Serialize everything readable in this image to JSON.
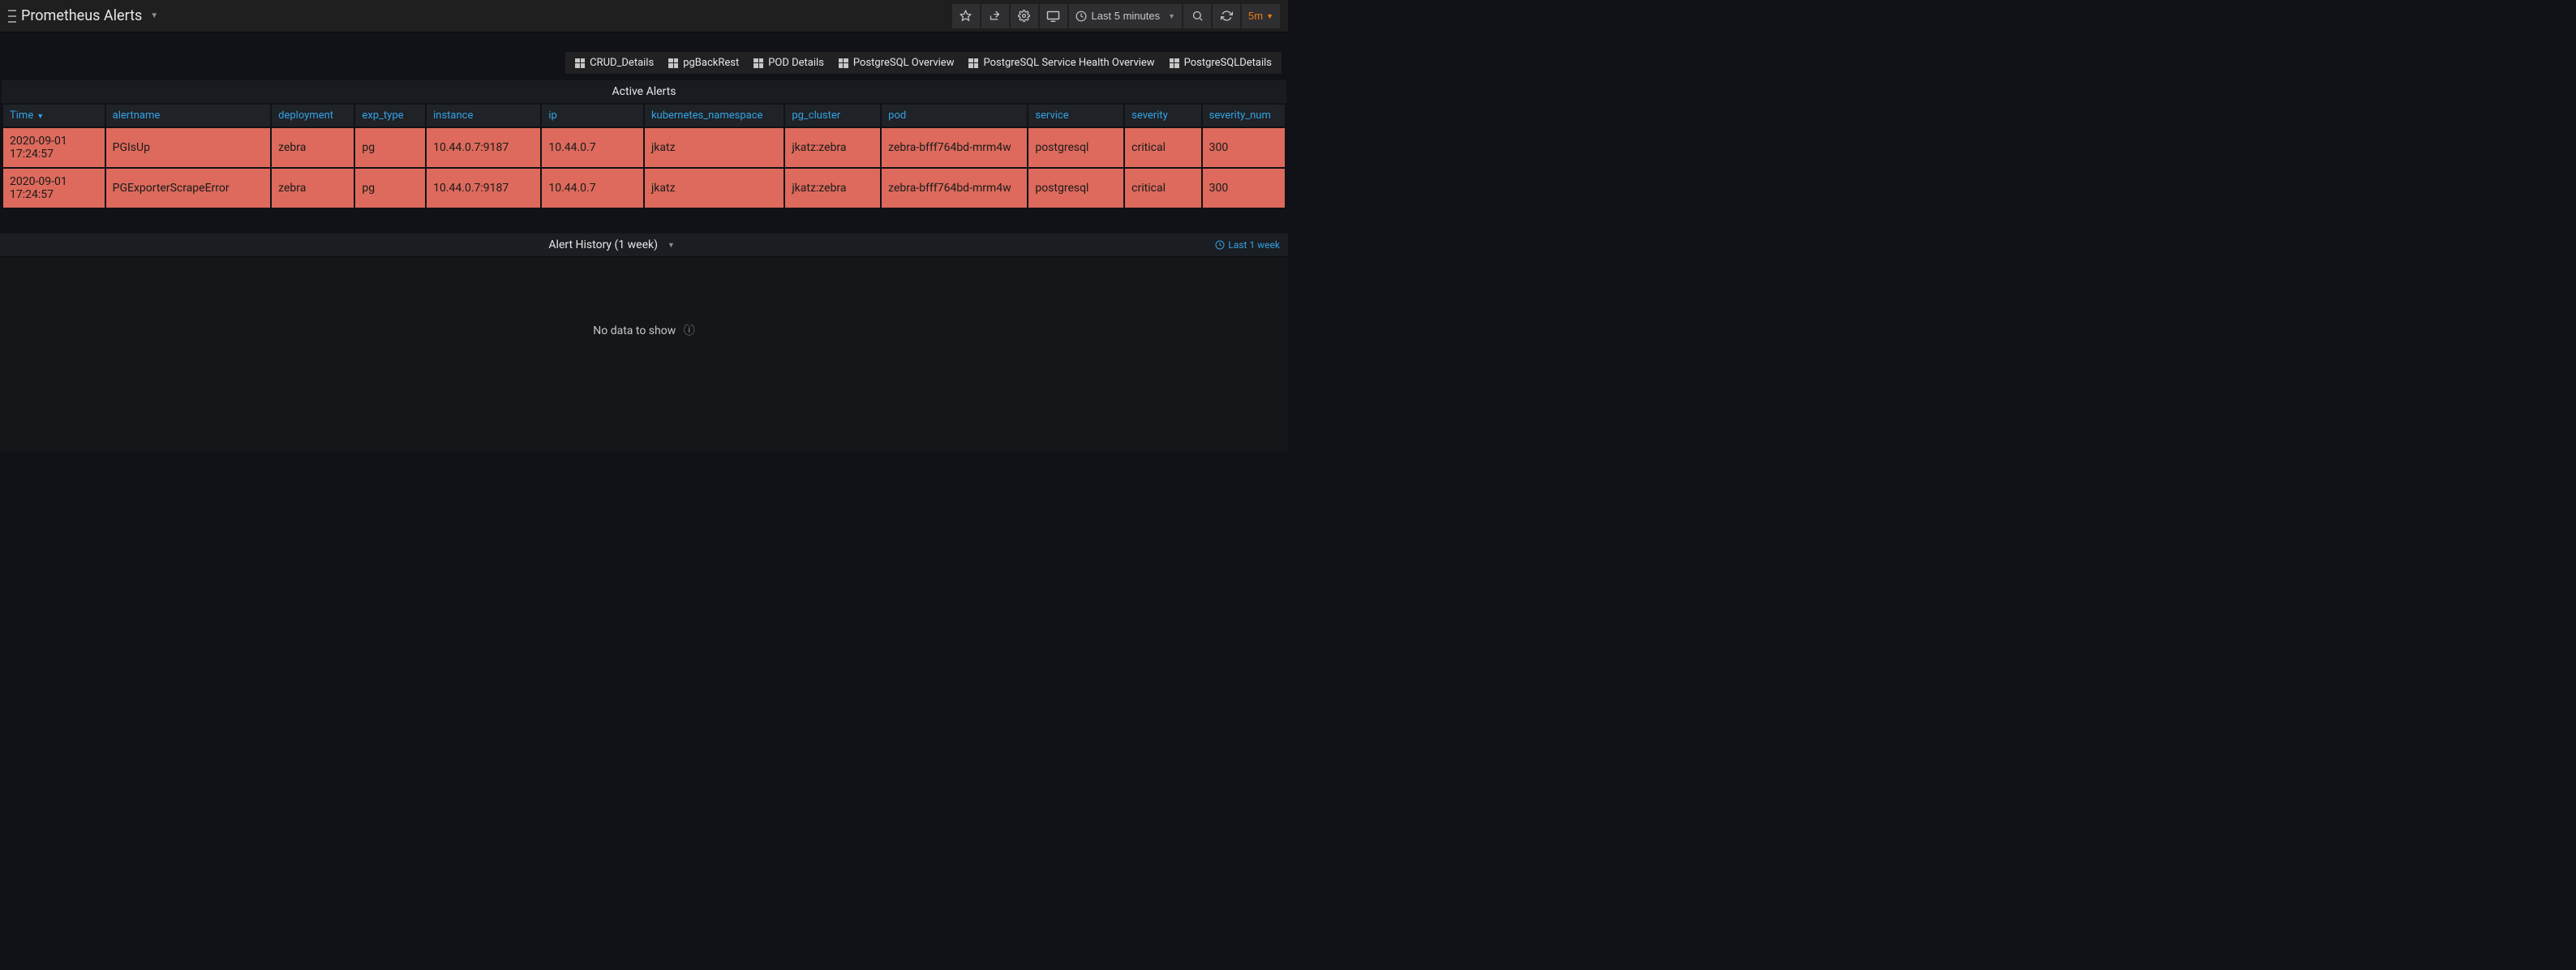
{
  "header": {
    "title": "Prometheus Alerts",
    "time_range": "Last 5 minutes",
    "refresh": "5m"
  },
  "links": [
    "CRUD_Details",
    "pgBackRest",
    "POD Details",
    "PostgreSQL Overview",
    "PostgreSQL Service Health Overview",
    "PostgreSQLDetails"
  ],
  "active_alerts": {
    "title": "Active Alerts",
    "columns": [
      "Time",
      "alertname",
      "deployment",
      "exp_type",
      "instance",
      "ip",
      "kubernetes_namespace",
      "pg_cluster",
      "pod",
      "service",
      "severity",
      "severity_num"
    ],
    "rows": [
      {
        "time": "2020-09-01 17:24:57",
        "alertname": "PGIsUp",
        "deployment": "zebra",
        "exp_type": "pg",
        "instance": "10.44.0.7:9187",
        "ip": "10.44.0.7",
        "ns": "jkatz",
        "cluster": "jkatz:zebra",
        "pod": "zebra-bfff764bd-mrm4w",
        "service": "postgresql",
        "severity": "critical",
        "num": "300"
      },
      {
        "time": "2020-09-01 17:24:57",
        "alertname": "PGExporterScrapeError",
        "deployment": "zebra",
        "exp_type": "pg",
        "instance": "10.44.0.7:9187",
        "ip": "10.44.0.7",
        "ns": "jkatz",
        "cluster": "jkatz:zebra",
        "pod": "zebra-bfff764bd-mrm4w",
        "service": "postgresql",
        "severity": "critical",
        "num": "300"
      }
    ]
  },
  "history": {
    "title": "Alert History (1 week)",
    "range_label": "Last 1 week",
    "empty": "No data to show"
  }
}
